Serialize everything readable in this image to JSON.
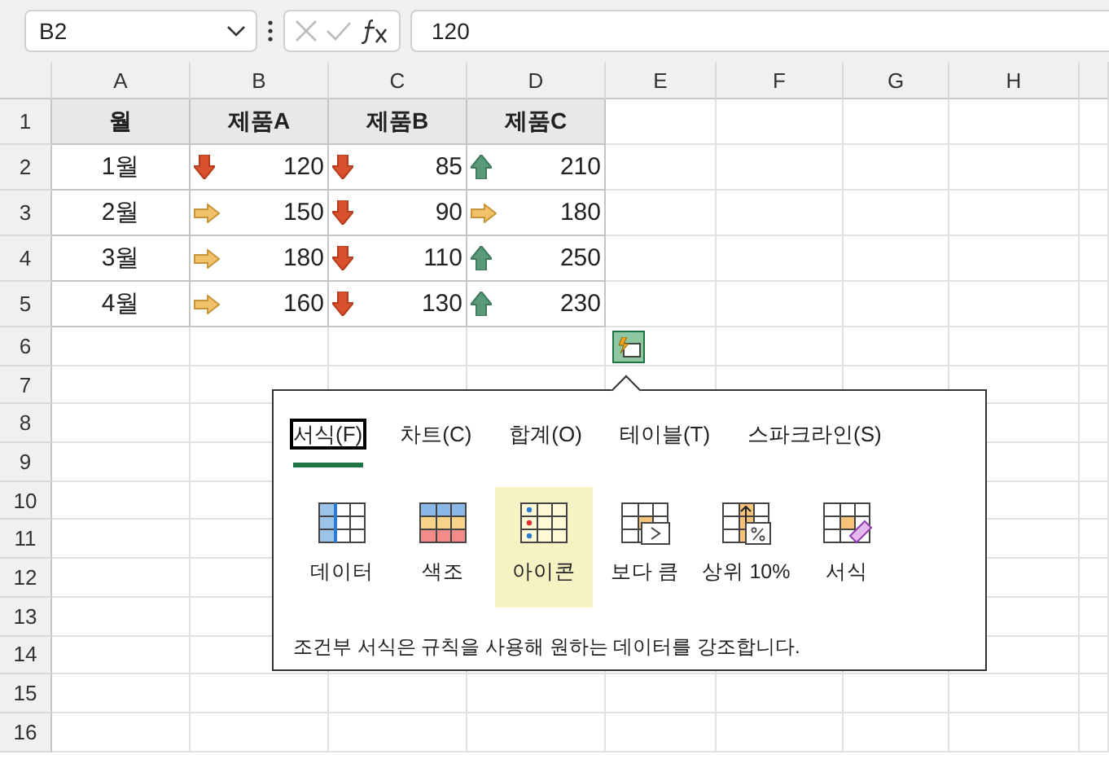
{
  "name_box": {
    "value": "B2"
  },
  "formula_bar": {
    "value": "120"
  },
  "columns": [
    "A",
    "B",
    "C",
    "D",
    "E",
    "F",
    "G",
    "H"
  ],
  "rows": [
    "1",
    "2",
    "3",
    "4",
    "5",
    "6",
    "7",
    "8",
    "9",
    "10",
    "11",
    "12",
    "13",
    "14",
    "15",
    "16"
  ],
  "table": {
    "header": [
      "월",
      "제품A",
      "제품B",
      "제품C"
    ],
    "rows": [
      {
        "month": "1월",
        "cells": [
          {
            "kind": "down",
            "value": "120"
          },
          {
            "kind": "down",
            "value": "85"
          },
          {
            "kind": "up",
            "value": "210"
          }
        ]
      },
      {
        "month": "2월",
        "cells": [
          {
            "kind": "flat",
            "value": "150"
          },
          {
            "kind": "down",
            "value": "90"
          },
          {
            "kind": "flat",
            "value": "180"
          }
        ]
      },
      {
        "month": "3월",
        "cells": [
          {
            "kind": "flat",
            "value": "180"
          },
          {
            "kind": "down",
            "value": "110"
          },
          {
            "kind": "up",
            "value": "250"
          }
        ]
      },
      {
        "month": "4월",
        "cells": [
          {
            "kind": "flat",
            "value": "160"
          },
          {
            "kind": "down",
            "value": "130"
          },
          {
            "kind": "up",
            "value": "230"
          }
        ]
      }
    ]
  },
  "quick_analysis": {
    "tabs": [
      {
        "label": "서식(F)",
        "selected": true
      },
      {
        "label": "차트(C)",
        "selected": false
      },
      {
        "label": "합계(O)",
        "selected": false
      },
      {
        "label": "테이블(T)",
        "selected": false
      },
      {
        "label": "스파크라인(S)",
        "selected": false
      }
    ],
    "options": [
      {
        "label": "데이터",
        "kind": "data-bars",
        "selected": false
      },
      {
        "label": "색조",
        "kind": "color-scale",
        "selected": false
      },
      {
        "label": "아이콘",
        "kind": "icon-set",
        "selected": true
      },
      {
        "label": "보다 큼",
        "kind": "greater-than",
        "selected": false
      },
      {
        "label": "상위 10%",
        "kind": "top-ten",
        "selected": false
      },
      {
        "label": "서식",
        "kind": "clear",
        "selected": false
      }
    ],
    "description": "조건부 서식은 규칙을 사용해 원하는 데이터를 강조합니다."
  }
}
